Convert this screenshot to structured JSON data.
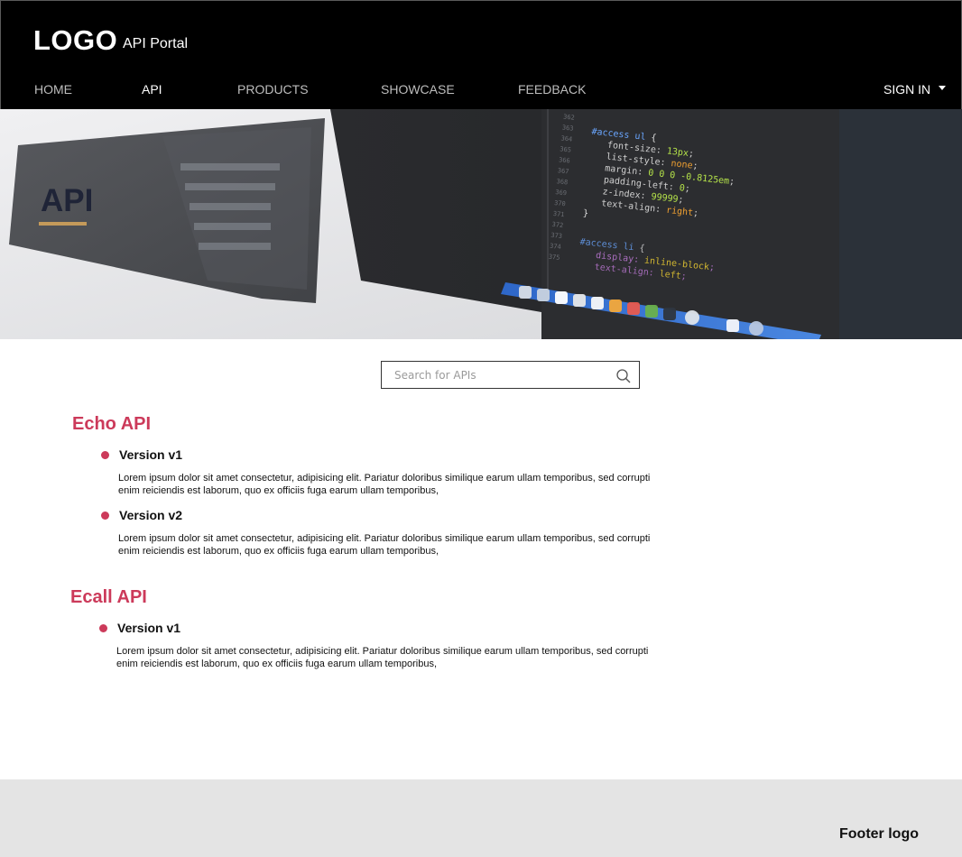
{
  "header": {
    "logo": "LOGO",
    "portal_name": "API Portal",
    "nav": [
      {
        "label": "HOME"
      },
      {
        "label": "API"
      },
      {
        "label": "PRODUCTS"
      },
      {
        "label": "SHOWCASE"
      },
      {
        "label": "FEEDBACK"
      }
    ],
    "active_nav": "API",
    "sign_in": "SIGN IN"
  },
  "hero": {
    "title": "API",
    "code_lines": [
      "#access ul {",
      "font-size: 13px;",
      "list-style: none;",
      "margin: 0 0 0 -0.8125em;",
      "padding-left: 0;",
      "z-index: 99999;",
      "text-align: right;",
      "}",
      "#access li {",
      "display: inline-block;",
      "text-align: left;"
    ],
    "line_numbers": [
      "362",
      "363",
      "364",
      "365",
      "366",
      "367",
      "368",
      "369",
      "370",
      "371",
      "372",
      "373",
      "374",
      "375"
    ]
  },
  "search": {
    "placeholder": "Search for APIs",
    "value": ""
  },
  "apis": [
    {
      "name": "Echo API",
      "versions": [
        {
          "label": "Version v1",
          "description": "Lorem ipsum dolor sit amet consectetur, adipisicing elit. Pariatur doloribus similique earum ullam temporibus, sed corrupti enim reiciendis est laborum, quo ex officiis fuga earum ullam temporibus,"
        },
        {
          "label": "Version v2",
          "description": "Lorem ipsum dolor sit amet consectetur, adipisicing elit. Pariatur doloribus similique earum ullam temporibus, sed corrupti enim reiciendis est laborum, quo ex officiis fuga earum ullam temporibus,"
        }
      ]
    },
    {
      "name": "Ecall API",
      "versions": [
        {
          "label": "Version v1",
          "description": "Lorem ipsum dolor sit amet consectetur, adipisicing elit. Pariatur doloribus similique earum ullam temporibus, sed corrupti enim reiciendis est laborum, quo ex officiis fuga earum ullam temporibus,"
        }
      ]
    }
  ],
  "footer": {
    "logo": "Footer logo"
  },
  "colors": {
    "header_bg": "#000000",
    "accent": "#cc3a5a",
    "hero_underline": "#c49a5a",
    "footer_bg": "#e4e4e4"
  },
  "icons": [
    "search-icon",
    "chevron-down-icon"
  ]
}
